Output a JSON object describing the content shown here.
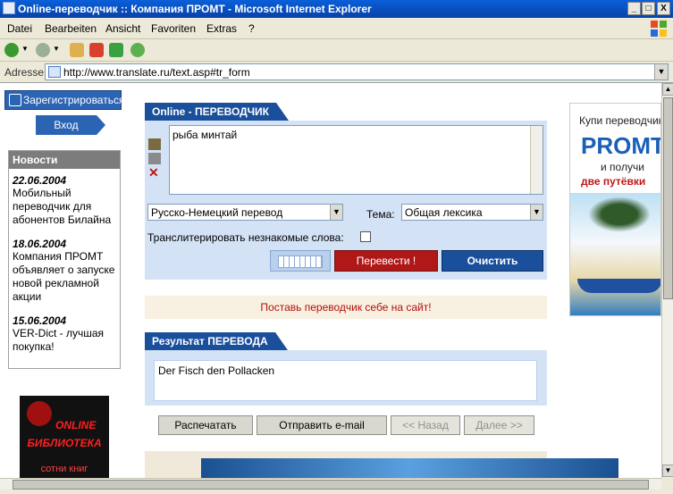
{
  "window": {
    "title": "Online-переводчик :: Компания ПРОМТ - Microsoft Internet Explorer",
    "min": "_",
    "max": "□",
    "close": "X"
  },
  "menu": {
    "items": [
      "Datei",
      "Bearbeiten",
      "Ansicht",
      "Favoriten",
      "Extras",
      "?"
    ]
  },
  "address": {
    "label": "Adresse",
    "url": "http://www.translate.ru/text.asp#tr_form"
  },
  "sidebar": {
    "register": "Зарегистрироваться",
    "login": "Вход",
    "news_title": "Новости",
    "news": [
      {
        "date": "22.06.2004",
        "text": "Мобильный переводчик для абонентов Билайна"
      },
      {
        "date": "18.06.2004",
        "text": "Компания ПРОМТ объявляет о запуске новой рекламной акции"
      },
      {
        "date": "15.06.2004",
        "text": "VER-Dict - лучшая покупка!"
      }
    ],
    "library": {
      "online": "ONLINE",
      "title": "БИБЛИОТЕКА",
      "sub": "сотни книг"
    }
  },
  "translator": {
    "tab_title": "Online - ПЕРЕВОДЧИК",
    "source_text": "рыба минтай",
    "direction": "Русско-Немецкий перевод",
    "topic_label": "Тема:",
    "topic": "Общая лексика",
    "translit_label": "Транслитерировать незнакомые слова:",
    "translate_button": "Перевести !",
    "clear_button": "Очистить",
    "promo": "Поставь переводчик себе на сайт!"
  },
  "result": {
    "tab_title": "Результат ПЕРЕВОДА",
    "text": "Der Fisch den Pollacken",
    "print_button": "Распечатать",
    "email_button": "Отправить e-mail",
    "back_button": "<< Назад",
    "next_button": "Далее >>"
  },
  "ad": {
    "line1": "Купи переводчик",
    "brand": "PROMT",
    "line2": "и получи",
    "line3": "две путёвки"
  }
}
